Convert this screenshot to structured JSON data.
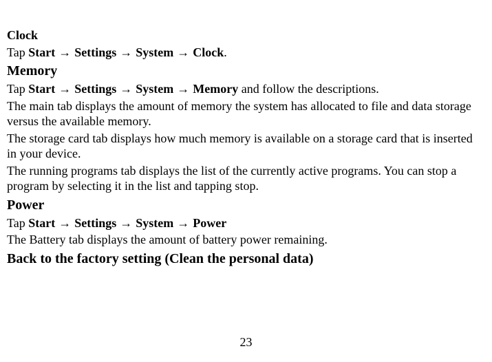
{
  "sections": {
    "clock": {
      "heading": "Clock",
      "tap_prefix": "Tap ",
      "start": "Start",
      "arrow": " → ",
      "settings": "Settings",
      "system": "System",
      "clock": "Clock",
      "period": "."
    },
    "memory": {
      "heading": "Memory",
      "tap_prefix": "Tap ",
      "start": "Start",
      "arrow": " → ",
      "settings": "Settings",
      "system": "System",
      "memory": "Memory",
      "suffix": " and follow the descriptions.",
      "p1": "The main tab displays the amount of memory the system has allocated to file and data storage versus the available memory.",
      "p2": "The storage card tab displays how much memory is available on a storage card that is inserted in your device.",
      "p3": "The running programs tab displays the list of the currently active programs. You can stop a program by selecting it in the list and tapping stop."
    },
    "power": {
      "heading": "Power",
      "tap_prefix": "Tap ",
      "start": "Start",
      "arrow": " → ",
      "settings": "Settings",
      "system": "System",
      "power": "Power",
      "p1": "The Battery tab displays the amount of battery power remaining."
    },
    "factory": {
      "heading": "Back to the factory setting (Clean the personal data)"
    }
  },
  "page_number": "23"
}
